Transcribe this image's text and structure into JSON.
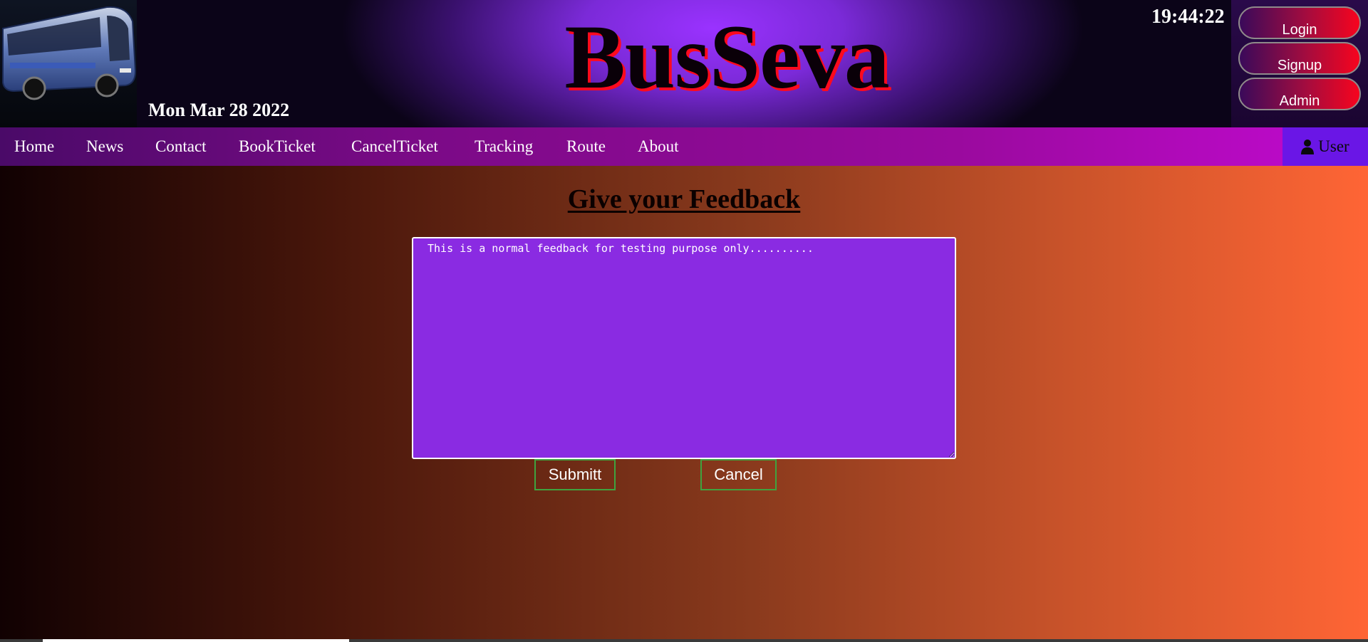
{
  "header": {
    "brand": "BusSeva",
    "date": "Mon Mar 28 2022",
    "clock": "19:44:22",
    "logo_icon": "bus-icon"
  },
  "auth": {
    "login": "Login",
    "signup": "Signup",
    "admin": "Admin"
  },
  "nav": {
    "items": [
      "Home",
      "News",
      "Contact",
      "BookTicket",
      "CancelTicket",
      "Tracking",
      "Route",
      "About"
    ],
    "user_label": "User",
    "user_icon": "user-icon"
  },
  "main": {
    "title": "Give your Feedback",
    "feedback_value": "This is a normal feedback for testing purpose only..........",
    "submit_label": "Submitt",
    "cancel_label": "Cancel"
  },
  "colors": {
    "textarea_bg": "#8a2be2",
    "nav_accent": "#9a0a9e",
    "user_area_bg": "#6a16e6",
    "button_border": "#3fa33f",
    "auth_button_red": "#f7041e"
  }
}
